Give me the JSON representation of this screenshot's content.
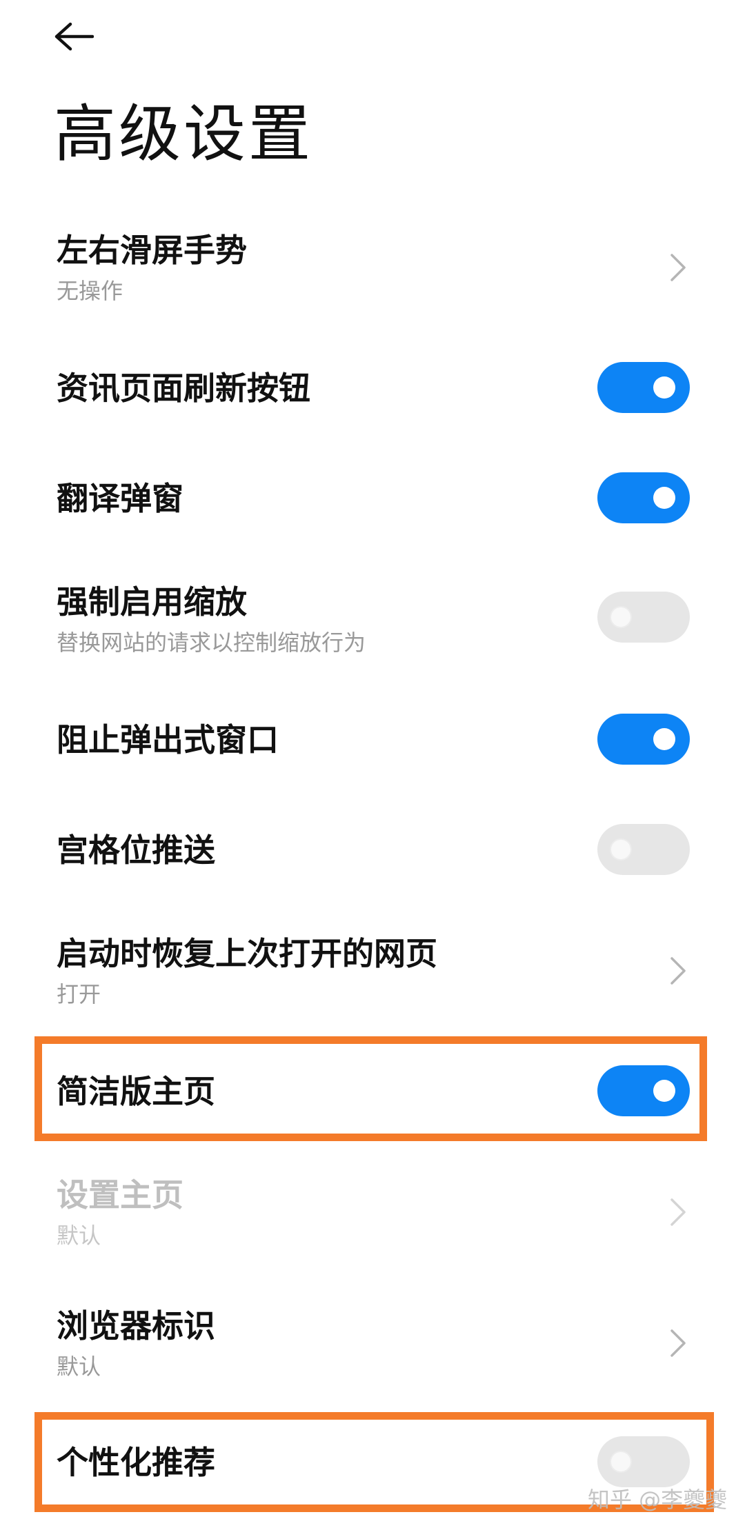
{
  "header": {
    "back_icon": "arrow-left-icon",
    "title": "高级设置"
  },
  "colors": {
    "toggle_on": "#0d84f5",
    "toggle_off": "#e6e6e6",
    "highlight": "#f47b2a"
  },
  "settings": [
    {
      "title": "左右滑屏手势",
      "subtitle": "无操作",
      "control": "chevron"
    },
    {
      "title": "资讯页面刷新按钮",
      "control": "toggle",
      "on": true
    },
    {
      "title": "翻译弹窗",
      "control": "toggle",
      "on": true
    },
    {
      "title": "强制启用缩放",
      "subtitle": "替换网站的请求以控制缩放行为",
      "control": "toggle",
      "on": false
    },
    {
      "title": "阻止弹出式窗口",
      "control": "toggle",
      "on": true
    },
    {
      "title": "宫格位推送",
      "control": "toggle",
      "on": false
    },
    {
      "title": "启动时恢复上次打开的网页",
      "subtitle": "打开",
      "control": "chevron"
    },
    {
      "title": "简洁版主页",
      "control": "toggle",
      "on": true,
      "highlighted": true
    },
    {
      "title": "设置主页",
      "subtitle": "默认",
      "control": "chevron",
      "disabled": true
    },
    {
      "title": "浏览器标识",
      "subtitle": "默认",
      "control": "chevron"
    },
    {
      "title": "个性化推荐",
      "control": "toggle",
      "on": false,
      "highlighted": true
    }
  ],
  "watermark": "知乎 @李夔夔"
}
